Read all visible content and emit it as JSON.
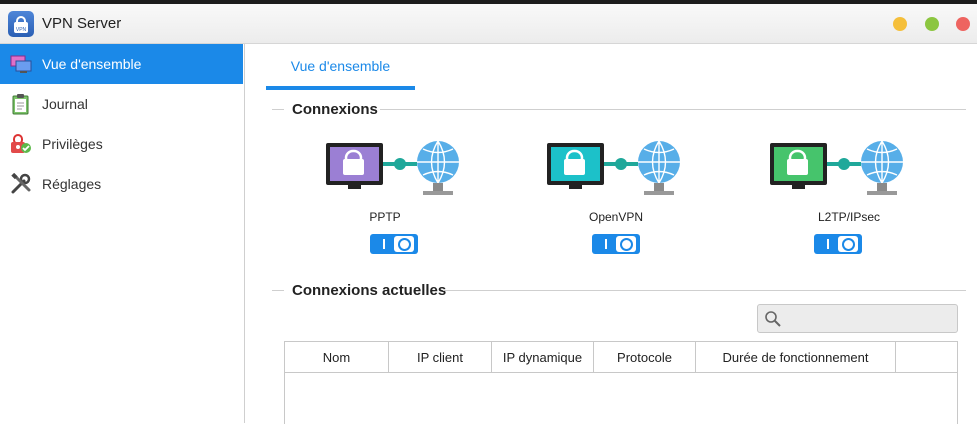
{
  "window": {
    "title": "VPN Server",
    "icon": "vpn-lock-icon",
    "controls": [
      "minimize",
      "maximize",
      "close"
    ]
  },
  "sidebar": {
    "items": [
      {
        "label": "Vue d'ensemble",
        "icon": "overview-monitor-icon",
        "active": true
      },
      {
        "label": "Journal",
        "icon": "log-notepad-icon",
        "active": false
      },
      {
        "label": "Privilèges",
        "icon": "privileges-lock-check-icon",
        "active": false
      },
      {
        "label": "Réglages",
        "icon": "settings-tools-icon",
        "active": false
      }
    ]
  },
  "tabs": [
    {
      "label": "Vue d'ensemble",
      "active": true
    }
  ],
  "connections": {
    "title": "Connexions",
    "services": [
      {
        "label": "PPTP",
        "enabled": true,
        "screen_color": "#9b7fd4"
      },
      {
        "label": "OpenVPN",
        "enabled": true,
        "screen_color": "#1cc1c9"
      },
      {
        "label": "L2TP/IPsec",
        "enabled": true,
        "screen_color": "#46c46c"
      }
    ]
  },
  "current_connections": {
    "title": "Connexions actuelles",
    "search": {
      "value": "",
      "placeholder": ""
    },
    "columns": [
      "Nom",
      "IP client",
      "IP dynamique",
      "Protocole",
      "Durée de fonctionnement",
      ""
    ],
    "rows": []
  },
  "colors": {
    "accent": "#1b89e8",
    "link": "#1fa89a"
  }
}
